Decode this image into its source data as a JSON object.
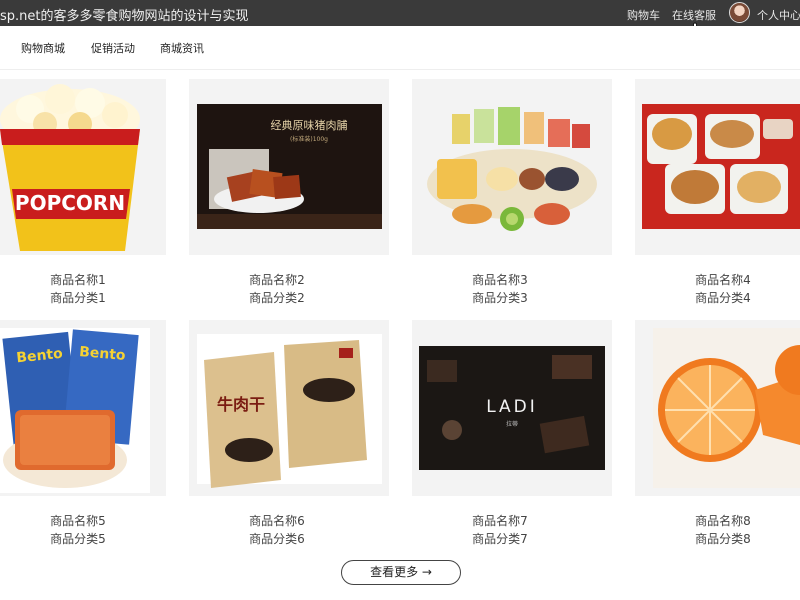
{
  "header": {
    "site_title": "sp.net的客多多零食购物网站的设计与实现",
    "links": [
      "购物车",
      "在线客服",
      "个人中心"
    ]
  },
  "nav": {
    "items": [
      "购物商城",
      "促销活动",
      "商城资讯"
    ]
  },
  "products": [
    {
      "name": "商品名称1",
      "category": "商品分类1",
      "image": "popcorn-image"
    },
    {
      "name": "商品名称2",
      "category": "商品分类2",
      "image": "pork-jerky-image",
      "image_text": [
        "经典原味猪肉脯",
        "(标准装)100g"
      ]
    },
    {
      "name": "商品名称3",
      "category": "商品分类3",
      "image": "snack-assortment-image"
    },
    {
      "name": "商品名称4",
      "category": "商品分类4",
      "image": "snack-bowls-image"
    },
    {
      "name": "商品名称5",
      "category": "商品分类5",
      "image": "bento-squid-image",
      "image_text": [
        "Bento"
      ]
    },
    {
      "name": "商品名称6",
      "category": "商品分类6",
      "image": "beef-jerky-image",
      "image_text": [
        "牛肉干"
      ]
    },
    {
      "name": "商品名称7",
      "category": "商品分类7",
      "image": "ladi-chocolate-image",
      "image_text": [
        "LADI"
      ]
    },
    {
      "name": "商品名称8",
      "category": "商品分类8",
      "image": "orange-image"
    }
  ],
  "more_button": {
    "label": "查看更多 →"
  }
}
